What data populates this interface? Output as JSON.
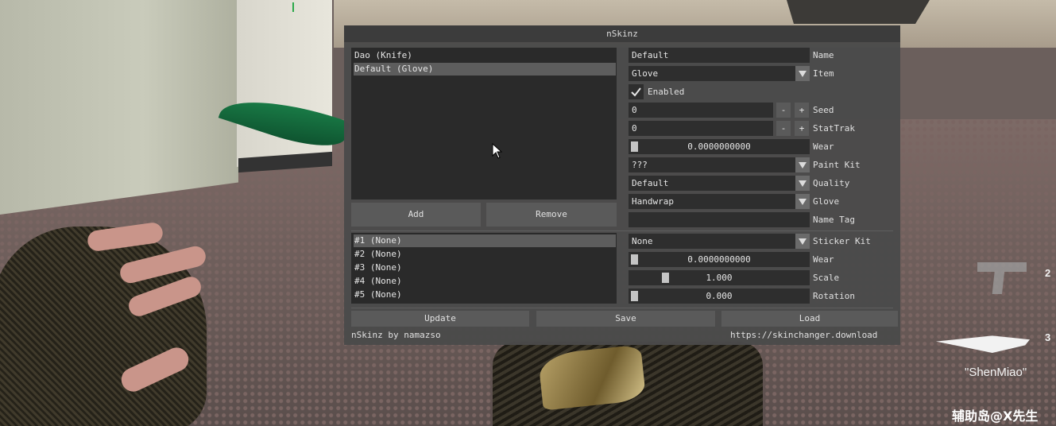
{
  "window": {
    "title": "nSkinz"
  },
  "skin_list": {
    "items": [
      "Dao (Knife)",
      "Default (Glove)"
    ],
    "selected_index": 1
  },
  "buttons": {
    "add": "Add",
    "remove": "Remove",
    "update": "Update",
    "save": "Save",
    "load": "Load"
  },
  "form": {
    "name": {
      "value": "Default",
      "label": "Name"
    },
    "item": {
      "value": "Glove",
      "label": "Item"
    },
    "enabled": {
      "label": "Enabled",
      "checked": true
    },
    "seed": {
      "value": "0",
      "label": "Seed"
    },
    "stattrak": {
      "value": "0",
      "label": "StatTrak"
    },
    "wear": {
      "value": "0.0000000000",
      "label": "Wear",
      "fraction": 0.0
    },
    "paint_kit": {
      "value": "???",
      "label": "Paint Kit"
    },
    "quality": {
      "value": "Default",
      "label": "Quality"
    },
    "glove": {
      "value": "Handwrap",
      "label": "Glove"
    },
    "name_tag": {
      "value": "",
      "label": "Name Tag"
    }
  },
  "stepper": {
    "minus": "-",
    "plus": "+"
  },
  "sticker_list": {
    "items": [
      "#1 (None)",
      "#2 (None)",
      "#3 (None)",
      "#4 (None)",
      "#5 (None)"
    ],
    "selected_index": 0
  },
  "sticker": {
    "kit": {
      "value": "None",
      "label": "Sticker Kit"
    },
    "wear": {
      "value": "0.0000000000",
      "label": "Wear",
      "fraction": 0.0
    },
    "scale": {
      "value": "1.000",
      "label": "Scale",
      "fraction": 0.2
    },
    "rotation": {
      "value": "0.000",
      "label": "Rotation",
      "fraction": 0.0
    }
  },
  "footer": {
    "credit": "nSkinz by namazso",
    "url": "https://skinchanger.download"
  },
  "hud": {
    "slot_2": "2",
    "slot_3": "3",
    "player_name": "\"ShenMiao\"",
    "watermark": "辅助岛@X先生"
  },
  "colors": {
    "window_bg": "#4a4a4a",
    "titlebar": "#3c3c3c",
    "field_bg": "#2e2e2e",
    "selected_row": "#5d5d5d"
  }
}
